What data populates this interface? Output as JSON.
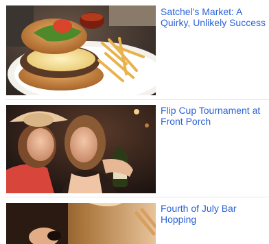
{
  "articles": [
    {
      "title": "Satchel's Market: A Quirky, Unlikely Success",
      "image_subject": "burger-and-fries-photo"
    },
    {
      "title": "Flip Cup Tournament at Front Porch",
      "image_subject": "two-women-party-photo"
    },
    {
      "title": "Fourth of July Bar Hopping",
      "image_subject": "bar-patrons-photo"
    }
  ],
  "colors": {
    "link": "#2a62d8",
    "divider": "#e4e4e4",
    "background": "#ffffff"
  }
}
